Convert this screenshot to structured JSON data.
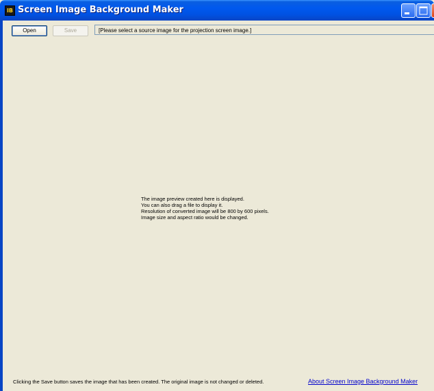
{
  "window": {
    "title": "Screen Image Background Maker",
    "app_icon_text": "IB"
  },
  "toolbar": {
    "open_label": "Open",
    "save_label": "Save",
    "path_text": "[Please select a source image for the projection screen image.]"
  },
  "preview": {
    "lines": [
      "The image preview created here is displayed.",
      "You can also drag a file to display it.",
      "Resolution of converted image will be 800 by 600 pixels.",
      "Image size and aspect ratio would be changed."
    ]
  },
  "footer": {
    "note": "Clicking the Save button saves the image that has been created. The original image is not changed or deleted.",
    "about_link": "About Screen Image Background Maker"
  },
  "colors": {
    "titlebar": "#0058ee",
    "window_bg": "#ece9d8",
    "link": "#0000cc",
    "close_button": "#d9431c"
  },
  "icons": [
    "app-icon",
    "minimize-icon",
    "maximize-icon",
    "close-icon"
  ]
}
